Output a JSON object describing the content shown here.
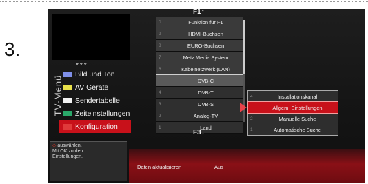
{
  "step_number": "3.",
  "tv": {
    "stars": "***",
    "side_title": "TV-Menü",
    "side_menu": [
      {
        "label": "Bild und Ton",
        "color": "#7f8fe8",
        "active": false
      },
      {
        "label": "AV Geräte",
        "color": "#e8e04a",
        "active": false
      },
      {
        "label": "Sendertabelle",
        "color": "#f2f2f2",
        "active": false
      },
      {
        "label": "Zeiteinstellungen",
        "color": "#2aa86a",
        "active": false
      },
      {
        "label": "Konfiguration",
        "color": "#e03a3a",
        "active": true
      }
    ],
    "help": {
      "line1": "auswählen.",
      "line2": "Mit OK zu den",
      "line3": "Einstellungen."
    },
    "f1_label": "F1↑",
    "f3_label": "F3↓",
    "middle_menu": [
      {
        "num": "0",
        "label": "Funktion für F1"
      },
      {
        "num": "9",
        "label": "HDMI-Buchsen"
      },
      {
        "num": "8",
        "label": "EURO-Buchsen"
      },
      {
        "num": "7",
        "label": "Metz Media System"
      },
      {
        "num": "6",
        "label": "Kabelnetzwerk (LAN)"
      },
      {
        "num": "",
        "label": "DVB-C",
        "selected": true
      },
      {
        "num": "4",
        "label": "DVB-T"
      },
      {
        "num": "3",
        "label": "DVB-S"
      },
      {
        "num": "2",
        "label": "Analog-TV"
      },
      {
        "num": "1",
        "label": "Land"
      }
    ],
    "sub_menu": [
      {
        "num": "4",
        "label": "Installationskanal"
      },
      {
        "num": "",
        "label": "Allgem. Einstellungen",
        "selected": true
      },
      {
        "num": "2",
        "label": "Manuelle Suche"
      },
      {
        "num": "1",
        "label": "Automatische Suche"
      }
    ],
    "bottom_bar": {
      "key": "Daten aktualisieren",
      "value": "Aus"
    }
  }
}
